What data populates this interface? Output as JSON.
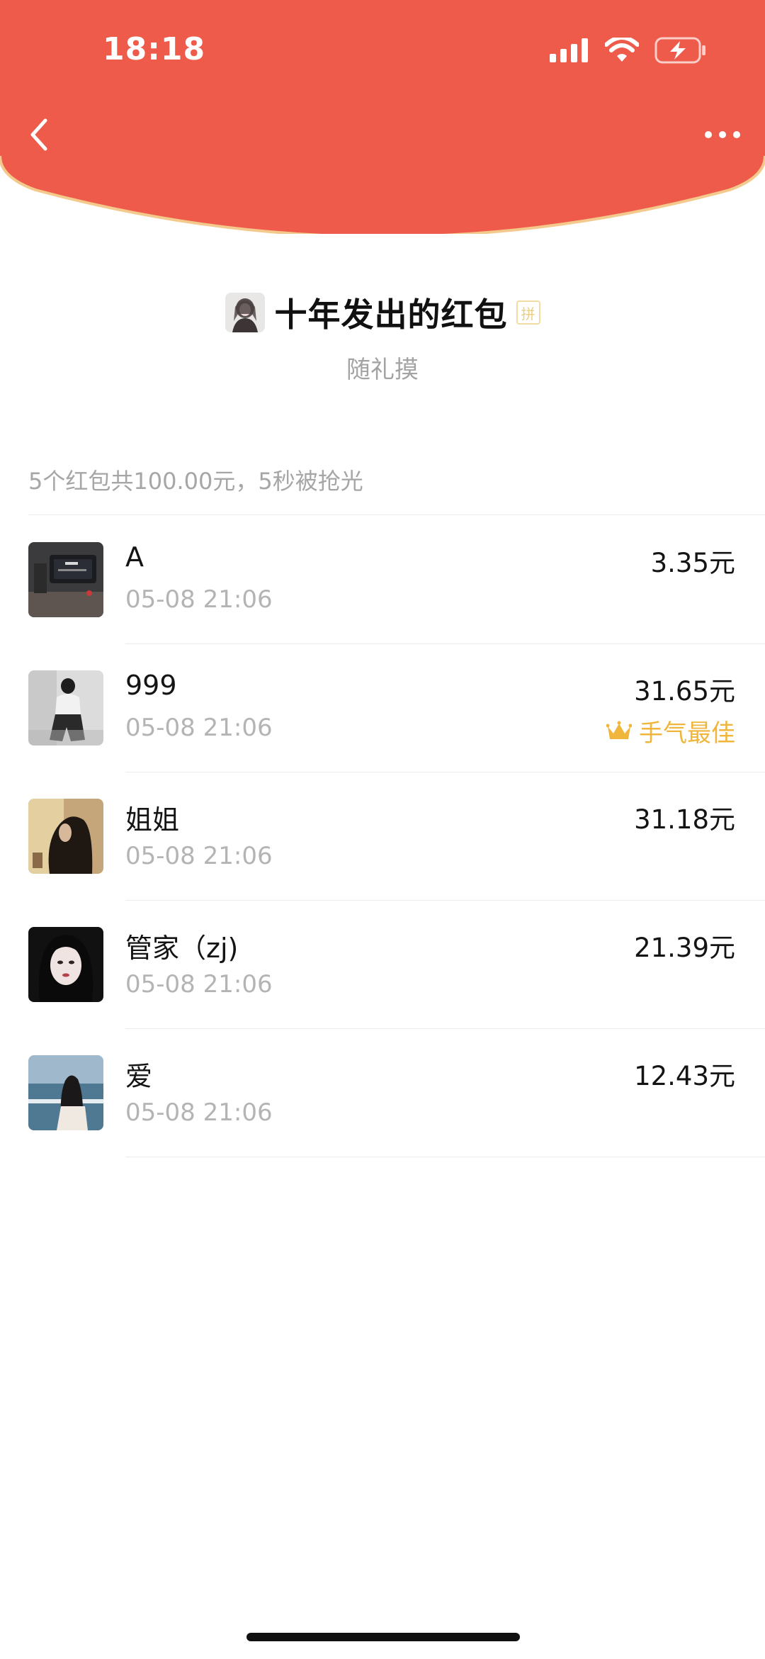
{
  "status_bar": {
    "time": "18:18"
  },
  "header": {
    "bg_color": "#ef5b4b",
    "curve_edge_color": "#f4c98c"
  },
  "packet": {
    "title": "十年发出的红包",
    "pin_badge": "拼",
    "subtitle": "随礼摸"
  },
  "summary": "5个红包共100.00元，5秒被抢光",
  "recipients": [
    {
      "name": "A",
      "time": "05-08 21:06",
      "amount": "3.35元",
      "best": ""
    },
    {
      "name": "999",
      "time": "05-08 21:06",
      "amount": "31.65元",
      "best": "手气最佳"
    },
    {
      "name": "姐姐",
      "time": "05-08 21:06",
      "amount": "31.18元",
      "best": ""
    },
    {
      "name": "管家（zj)",
      "time": "05-08 21:06",
      "amount": "21.39元",
      "best": ""
    },
    {
      "name": "爱",
      "time": "05-08 21:06",
      "amount": "12.43元",
      "best": ""
    }
  ],
  "icons": {
    "back": "chevron-left-icon",
    "more": "more-dots-icon",
    "best_luck": "crown-icon"
  },
  "colors": {
    "accent_red": "#ef5b4b",
    "best_luck_gold": "#f0b63c",
    "secondary_text": "#a6a6a6"
  }
}
